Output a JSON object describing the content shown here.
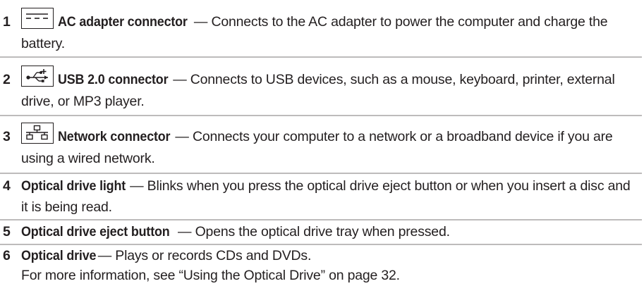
{
  "items": [
    {
      "number": "1",
      "icon": "ac-adapter-icon",
      "title": "AC adapter connector",
      "dash": " — ",
      "description": "Connects to the AC adapter to power the computer and charge the battery."
    },
    {
      "number": "2",
      "icon": "usb-icon",
      "title": "USB 2.0 connector",
      "dash": " — ",
      "description": "Connects to USB devices, such as a mouse, keyboard, printer, external drive, or MP3 player."
    },
    {
      "number": "3",
      "icon": "network-icon",
      "title": "Network connector",
      "dash": " — ",
      "description": "Connects your computer to a network or a broadband device if you are using a wired network."
    },
    {
      "number": "4",
      "title": "Optical drive light",
      "dash": " — ",
      "description": "Blinks when you press the optical drive eject button or when you insert a disc and it is being read."
    },
    {
      "number": "5",
      "title": "Optical drive eject button",
      "dash": " — ",
      "description": "Opens the optical drive tray when pressed."
    },
    {
      "number": "6",
      "title": "Optical drive",
      "dash": " — ",
      "description": "Plays or records CDs and DVDs."
    }
  ],
  "note": "For more information, see “Using the Optical Drive” on page 32.",
  "colors": {
    "text": "#231f20",
    "divider": "#bdbbbb"
  }
}
